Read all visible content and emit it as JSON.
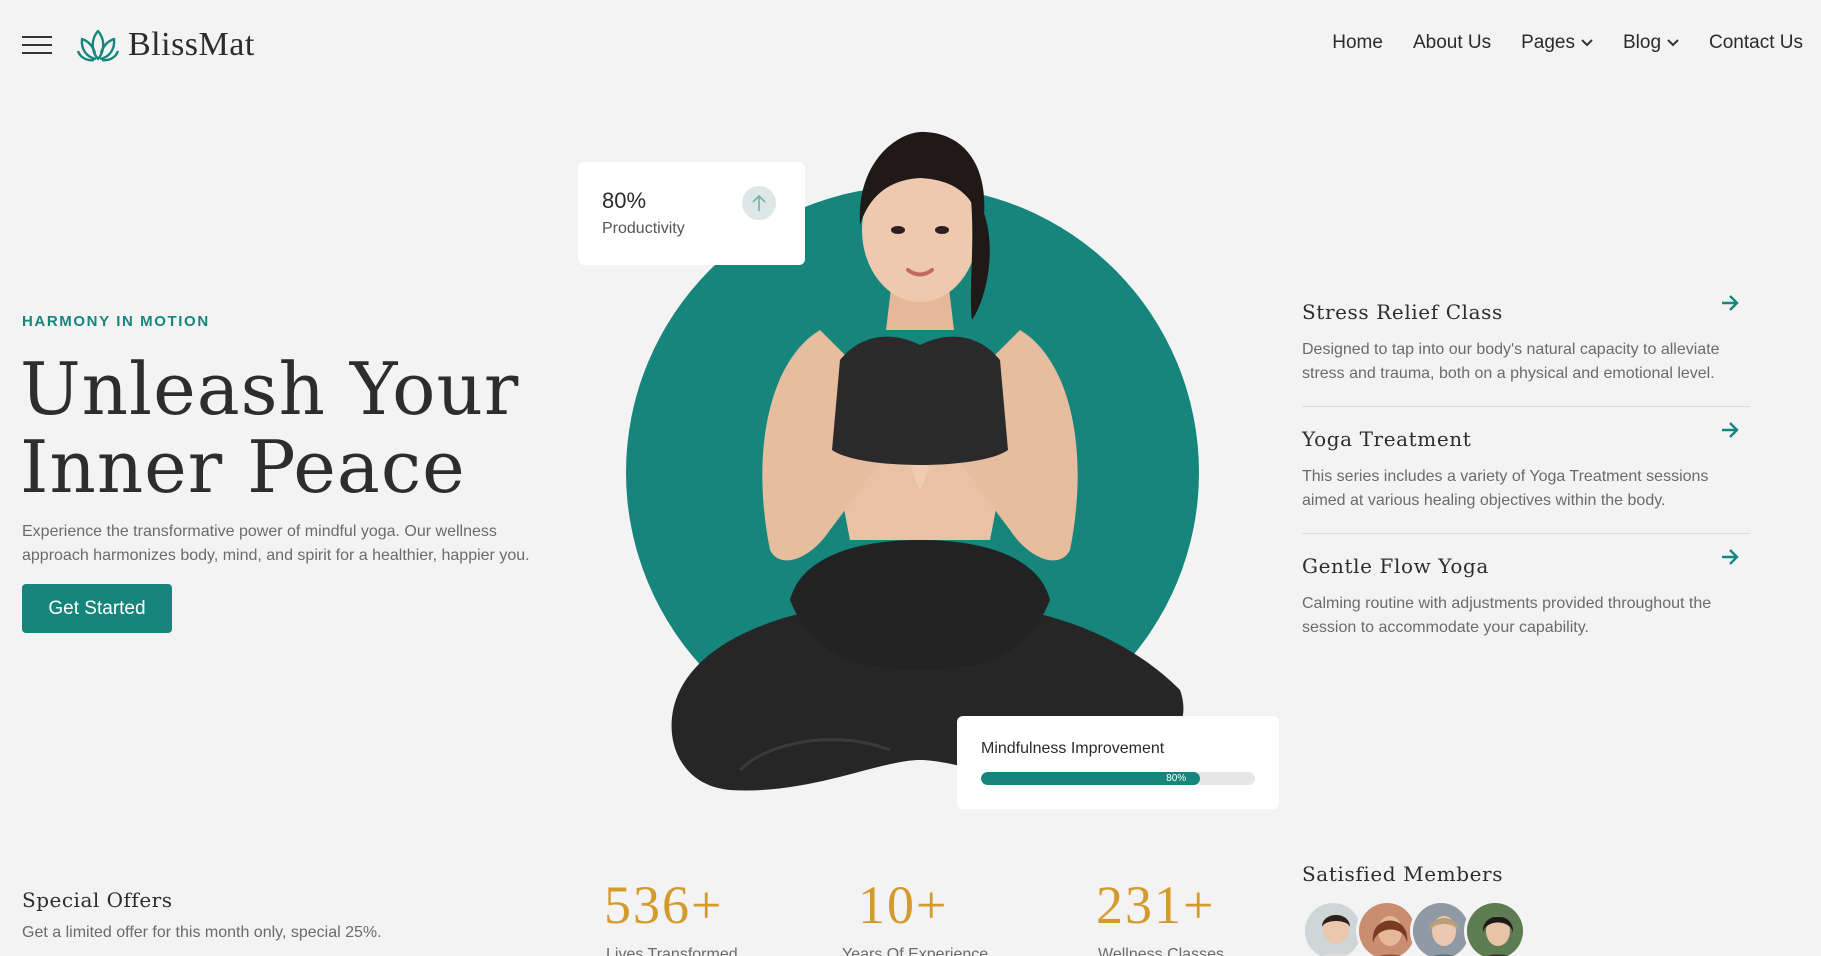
{
  "header": {
    "logo_text": "BlissMat",
    "nav": [
      {
        "label": "Home",
        "dropdown": false
      },
      {
        "label": "About Us",
        "dropdown": false
      },
      {
        "label": "Pages",
        "dropdown": true
      },
      {
        "label": "Blog",
        "dropdown": true
      },
      {
        "label": "Contact Us",
        "dropdown": false
      }
    ]
  },
  "hero": {
    "eyebrow": "HARMONY IN MOTION",
    "title_line1": "Unleash Your",
    "title_line2": "Inner Peace",
    "description": "Experience the transformative power of mindful yoga. Our wellness approach harmonizes body, mind, and spirit for a healthier, happier you.",
    "cta_label": "Get Started"
  },
  "productivity_card": {
    "value": "80%",
    "label": "Productivity"
  },
  "mindfulness_card": {
    "title": "Mindfulness Improvement",
    "progress_label": "80%",
    "progress_fraction": 0.8
  },
  "services": [
    {
      "title": "Stress Relief Class",
      "description": "Designed to tap into our body's natural capacity to alleviate stress and trauma, both on a physical and emotional level."
    },
    {
      "title": "Yoga Treatment",
      "description": "This series includes a variety of Yoga Treatment sessions aimed at various healing objectives within the body."
    },
    {
      "title": "Gentle Flow Yoga",
      "description": "Calming routine with adjustments provided throughout the session to accommodate your capability."
    }
  ],
  "offer": {
    "title": "Special Offers",
    "description": "Get a limited offer for this month only, special 25%."
  },
  "stats": [
    {
      "value": "536+",
      "label": "Lives Transformed"
    },
    {
      "value": "10+",
      "label": "Years Of Experience"
    },
    {
      "value": "231+",
      "label": "Wellness Classes"
    }
  ],
  "members_title": "Satisfied Members",
  "colors": {
    "accent": "#16867c",
    "gold": "#d39a2c",
    "background": "#f3f3f3"
  }
}
